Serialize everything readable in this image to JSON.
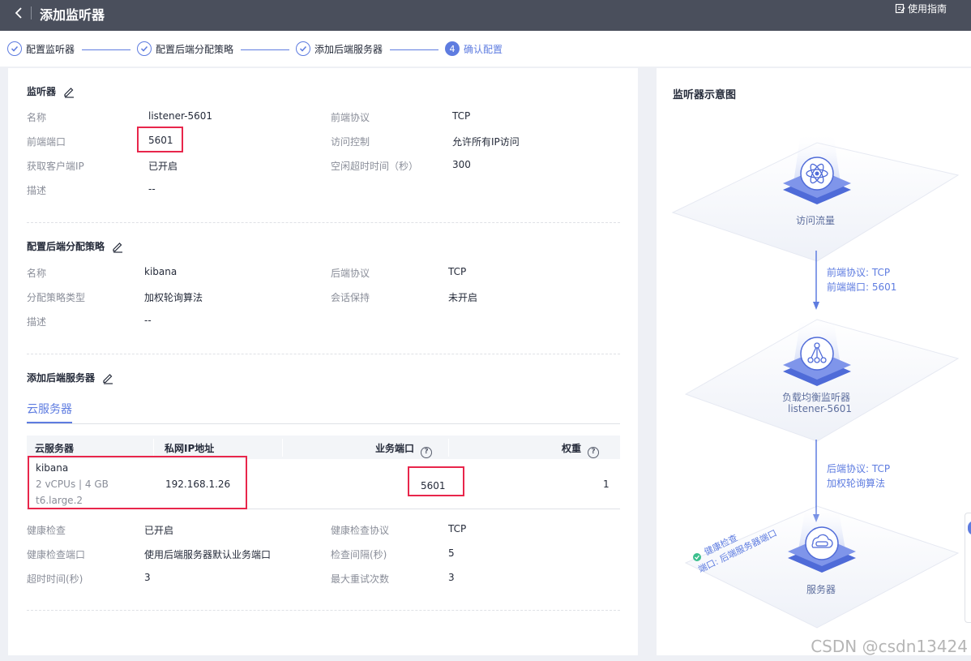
{
  "header": {
    "back_icon": "chevron-left-icon",
    "title": "添加监听器",
    "guide": "使用指南"
  },
  "steps": [
    {
      "label": "配置监听器",
      "state": "done"
    },
    {
      "label": "配置后端分配策略",
      "state": "done"
    },
    {
      "label": "添加后端服务器",
      "state": "done"
    },
    {
      "label": "确认配置",
      "state": "active",
      "num": "4"
    }
  ],
  "listener": {
    "title": "监听器",
    "name_label": "名称",
    "name": "listener-5601",
    "port_label": "前端端口",
    "port": "5601",
    "client_ip_label": "获取客户端IP",
    "client_ip": "已开启",
    "desc_label": "描述",
    "desc": "--",
    "protocol_label": "前端协议",
    "protocol": "TCP",
    "acl_label": "访问控制",
    "acl": "允许所有IP访问",
    "idle_label": "空闲超时时间（秒）",
    "idle": "300"
  },
  "policy": {
    "title": "配置后端分配策略",
    "name_label": "名称",
    "name": "kibana",
    "type_label": "分配策略类型",
    "type": "加权轮询算法",
    "desc_label": "描述",
    "desc": "--",
    "protocol_label": "后端协议",
    "protocol": "TCP",
    "session_label": "会话保持",
    "session": "未开启"
  },
  "servers": {
    "title": "添加后端服务器",
    "tab": "云服务器",
    "columns": [
      "云服务器",
      "私网IP地址",
      "业务端口",
      "权重"
    ],
    "rows": [
      {
        "name": "kibana",
        "spec": "2 vCPUs | 4 GB",
        "flavor": "t6.large.2",
        "ip": "192.168.1.26",
        "port": "5601",
        "weight": "1"
      }
    ],
    "hc_label": "健康检查",
    "hc": "已开启",
    "hc_port_label": "健康检查端口",
    "hc_port": "使用后端服务器默认业务端口",
    "timeout_label": "超时时间(秒)",
    "timeout": "3",
    "hc_proto_label": "健康检查协议",
    "hc_proto": "TCP",
    "interval_label": "检查间隔(秒)",
    "interval": "5",
    "retry_label": "最大重试次数",
    "retry": "3"
  },
  "diagram": {
    "title": "监听器示意图",
    "traffic": "访问流量",
    "front_proto": "前端协议: TCP",
    "front_port": "前端端口: 5601",
    "lb_name": "负载均衡监听器",
    "lb_listener": "listener-5601",
    "back_proto": "后端协议: TCP",
    "back_algo": "加权轮询算法",
    "server": "服务器",
    "health": "健康检查",
    "health_port": "端口: 后端服务器端口"
  },
  "watermark": "CSDN @csdn13424",
  "colors": {
    "accent": "#5e7ce0",
    "highlight": "#e8264b",
    "header": "#4a4f5c"
  }
}
